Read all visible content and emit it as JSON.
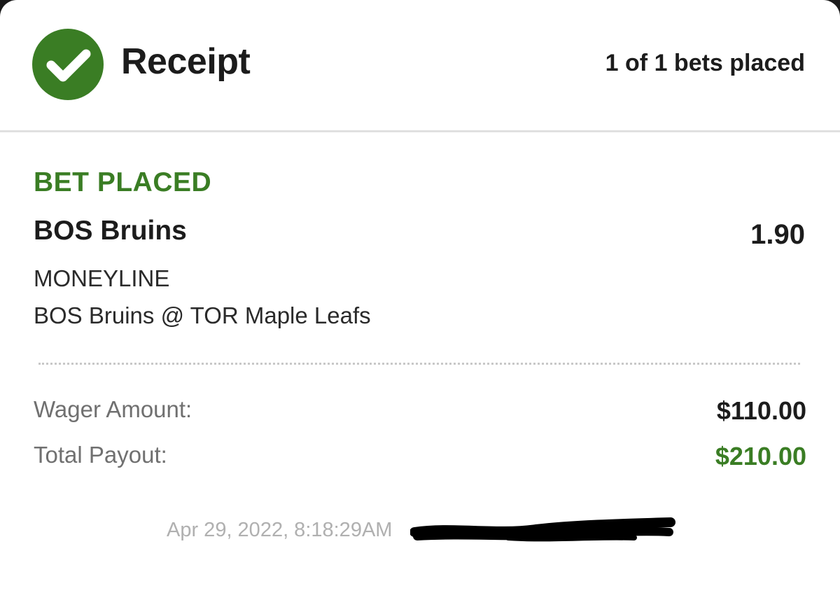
{
  "header": {
    "title": "Receipt",
    "bets_placed": "1 of 1 bets placed",
    "status_icon": "checkmark-circle-icon"
  },
  "bet": {
    "status": "BET PLACED",
    "selection": "BOS Bruins",
    "odds": "1.90",
    "market": "MONEYLINE",
    "event": "BOS Bruins @ TOR Maple Leafs"
  },
  "summary": {
    "wager_label": "Wager Amount:",
    "wager_value": "$110.00",
    "payout_label": "Total Payout:",
    "payout_value": "$210.00"
  },
  "footer": {
    "timestamp": "Apr 29, 2022, 8:18:29AM"
  },
  "colors": {
    "accent_green": "#3a7d24",
    "text_dark": "#1c1c1c",
    "text_muted": "#707070",
    "text_faint": "#b0b0b0"
  }
}
